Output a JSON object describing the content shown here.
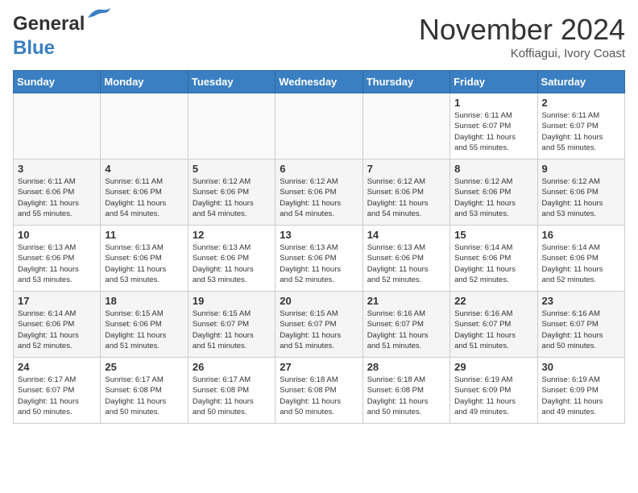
{
  "header": {
    "logo_line1": "General",
    "logo_line2": "Blue",
    "month": "November 2024",
    "location": "Koffiagui, Ivory Coast"
  },
  "weekdays": [
    "Sunday",
    "Monday",
    "Tuesday",
    "Wednesday",
    "Thursday",
    "Friday",
    "Saturday"
  ],
  "weeks": [
    [
      {
        "day": "",
        "info": ""
      },
      {
        "day": "",
        "info": ""
      },
      {
        "day": "",
        "info": ""
      },
      {
        "day": "",
        "info": ""
      },
      {
        "day": "",
        "info": ""
      },
      {
        "day": "1",
        "info": "Sunrise: 6:11 AM\nSunset: 6:07 PM\nDaylight: 11 hours\nand 55 minutes."
      },
      {
        "day": "2",
        "info": "Sunrise: 6:11 AM\nSunset: 6:07 PM\nDaylight: 11 hours\nand 55 minutes."
      }
    ],
    [
      {
        "day": "3",
        "info": "Sunrise: 6:11 AM\nSunset: 6:06 PM\nDaylight: 11 hours\nand 55 minutes."
      },
      {
        "day": "4",
        "info": "Sunrise: 6:11 AM\nSunset: 6:06 PM\nDaylight: 11 hours\nand 54 minutes."
      },
      {
        "day": "5",
        "info": "Sunrise: 6:12 AM\nSunset: 6:06 PM\nDaylight: 11 hours\nand 54 minutes."
      },
      {
        "day": "6",
        "info": "Sunrise: 6:12 AM\nSunset: 6:06 PM\nDaylight: 11 hours\nand 54 minutes."
      },
      {
        "day": "7",
        "info": "Sunrise: 6:12 AM\nSunset: 6:06 PM\nDaylight: 11 hours\nand 54 minutes."
      },
      {
        "day": "8",
        "info": "Sunrise: 6:12 AM\nSunset: 6:06 PM\nDaylight: 11 hours\nand 53 minutes."
      },
      {
        "day": "9",
        "info": "Sunrise: 6:12 AM\nSunset: 6:06 PM\nDaylight: 11 hours\nand 53 minutes."
      }
    ],
    [
      {
        "day": "10",
        "info": "Sunrise: 6:13 AM\nSunset: 6:06 PM\nDaylight: 11 hours\nand 53 minutes."
      },
      {
        "day": "11",
        "info": "Sunrise: 6:13 AM\nSunset: 6:06 PM\nDaylight: 11 hours\nand 53 minutes."
      },
      {
        "day": "12",
        "info": "Sunrise: 6:13 AM\nSunset: 6:06 PM\nDaylight: 11 hours\nand 53 minutes."
      },
      {
        "day": "13",
        "info": "Sunrise: 6:13 AM\nSunset: 6:06 PM\nDaylight: 11 hours\nand 52 minutes."
      },
      {
        "day": "14",
        "info": "Sunrise: 6:13 AM\nSunset: 6:06 PM\nDaylight: 11 hours\nand 52 minutes."
      },
      {
        "day": "15",
        "info": "Sunrise: 6:14 AM\nSunset: 6:06 PM\nDaylight: 11 hours\nand 52 minutes."
      },
      {
        "day": "16",
        "info": "Sunrise: 6:14 AM\nSunset: 6:06 PM\nDaylight: 11 hours\nand 52 minutes."
      }
    ],
    [
      {
        "day": "17",
        "info": "Sunrise: 6:14 AM\nSunset: 6:06 PM\nDaylight: 11 hours\nand 52 minutes."
      },
      {
        "day": "18",
        "info": "Sunrise: 6:15 AM\nSunset: 6:06 PM\nDaylight: 11 hours\nand 51 minutes."
      },
      {
        "day": "19",
        "info": "Sunrise: 6:15 AM\nSunset: 6:07 PM\nDaylight: 11 hours\nand 51 minutes."
      },
      {
        "day": "20",
        "info": "Sunrise: 6:15 AM\nSunset: 6:07 PM\nDaylight: 11 hours\nand 51 minutes."
      },
      {
        "day": "21",
        "info": "Sunrise: 6:16 AM\nSunset: 6:07 PM\nDaylight: 11 hours\nand 51 minutes."
      },
      {
        "day": "22",
        "info": "Sunrise: 6:16 AM\nSunset: 6:07 PM\nDaylight: 11 hours\nand 51 minutes."
      },
      {
        "day": "23",
        "info": "Sunrise: 6:16 AM\nSunset: 6:07 PM\nDaylight: 11 hours\nand 50 minutes."
      }
    ],
    [
      {
        "day": "24",
        "info": "Sunrise: 6:17 AM\nSunset: 6:07 PM\nDaylight: 11 hours\nand 50 minutes."
      },
      {
        "day": "25",
        "info": "Sunrise: 6:17 AM\nSunset: 6:08 PM\nDaylight: 11 hours\nand 50 minutes."
      },
      {
        "day": "26",
        "info": "Sunrise: 6:17 AM\nSunset: 6:08 PM\nDaylight: 11 hours\nand 50 minutes."
      },
      {
        "day": "27",
        "info": "Sunrise: 6:18 AM\nSunset: 6:08 PM\nDaylight: 11 hours\nand 50 minutes."
      },
      {
        "day": "28",
        "info": "Sunrise: 6:18 AM\nSunset: 6:08 PM\nDaylight: 11 hours\nand 50 minutes."
      },
      {
        "day": "29",
        "info": "Sunrise: 6:19 AM\nSunset: 6:09 PM\nDaylight: 11 hours\nand 49 minutes."
      },
      {
        "day": "30",
        "info": "Sunrise: 6:19 AM\nSunset: 6:09 PM\nDaylight: 11 hours\nand 49 minutes."
      }
    ]
  ]
}
